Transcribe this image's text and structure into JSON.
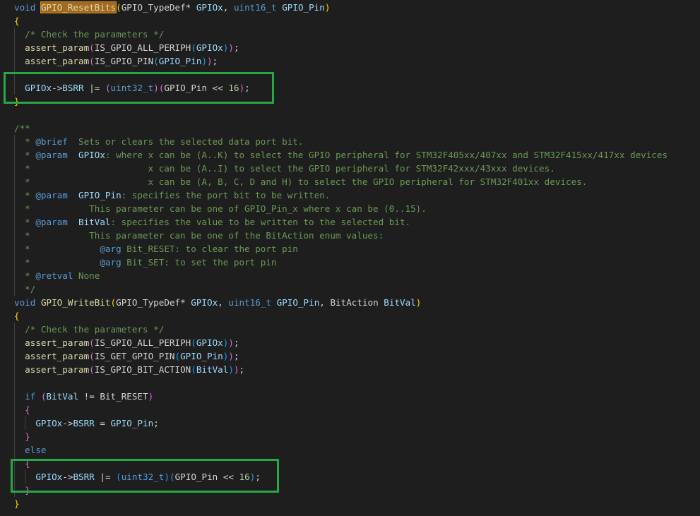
{
  "editor": {
    "lines": [
      [
        [
          "kw",
          "void"
        ],
        [
          "",
          "·"
        ],
        [
          "fn hl",
          "GPIO_ResetBits"
        ],
        [
          "p1",
          "("
        ],
        [
          "",
          "GPIO_TypeDef*"
        ],
        [
          "",
          ""
        ],
        [
          "pm",
          " GPIOx"
        ],
        [
          "",
          ", "
        ],
        [
          "kw",
          "uint16_t"
        ],
        [
          "pm",
          " GPIO_Pin"
        ],
        [
          "p1",
          ")"
        ]
      ],
      [
        [
          "p1",
          "{"
        ]
      ],
      [
        [
          "",
          ""
        ],
        [
          "cm",
          "/* Check the parameters */"
        ]
      ],
      [
        [
          "",
          ""
        ],
        [
          "fn",
          "assert_param"
        ],
        [
          "p2",
          "("
        ],
        [
          "",
          "IS_GPIO_ALL_PERIPH"
        ],
        [
          "p3",
          "("
        ],
        [
          "pm",
          "GPIOx"
        ],
        [
          "p3",
          ")"
        ],
        [
          "p2",
          ")"
        ],
        [
          "",
          ";"
        ]
      ],
      [
        [
          "",
          ""
        ],
        [
          "fn",
          "assert_param"
        ],
        [
          "p2",
          "("
        ],
        [
          "",
          "IS_GPIO_PIN"
        ],
        [
          "p3",
          "("
        ],
        [
          "pm",
          "GPIO_Pin"
        ],
        [
          "p3",
          ")"
        ],
        [
          "p2",
          ")"
        ],
        [
          "",
          ";"
        ]
      ],
      [],
      [
        [
          "",
          ""
        ],
        [
          "pm",
          "GPIOx"
        ],
        [
          "",
          "->"
        ],
        [
          "pm",
          "BSRR"
        ],
        [
          "",
          " |= "
        ],
        [
          "p2",
          "("
        ],
        [
          "kw",
          "uint32_t"
        ],
        [
          "p2",
          ")"
        ],
        [
          "p2",
          "("
        ],
        [
          "",
          "GPIO_Pin << "
        ],
        [
          "num",
          "16"
        ],
        [
          "p2",
          ")"
        ],
        [
          "",
          ";"
        ]
      ],
      [
        [
          "p1",
          "}"
        ]
      ],
      [],
      [
        [
          "cm",
          "/**"
        ]
      ],
      [
        [
          "cm",
          "  * "
        ],
        [
          "doc",
          "@brief"
        ],
        [
          "cm",
          "  Sets or clears the selected data port bit."
        ]
      ],
      [
        [
          "cm",
          "  * "
        ],
        [
          "doc",
          "@param"
        ],
        [
          "cm",
          "  "
        ],
        [
          "pm",
          "GPIOx"
        ],
        [
          "cm",
          ": where x can be (A..K) to select the GPIO peripheral for STM32F405xx/407xx and STM32F415xx/417xx devices"
        ]
      ],
      [
        [
          "cm",
          "  *                      x can be (A..I) to select the GPIO peripheral for STM32F42xxx/43xxx devices."
        ]
      ],
      [
        [
          "cm",
          "  *                      x can be (A, B, C, D and H) to select the GPIO peripheral for STM32F401xx devices."
        ]
      ],
      [
        [
          "cm",
          "  * "
        ],
        [
          "doc",
          "@param"
        ],
        [
          "cm",
          "  "
        ],
        [
          "pm",
          "GPIO_Pin"
        ],
        [
          "cm",
          ": specifies the port bit to be written."
        ]
      ],
      [
        [
          "cm",
          "  *           This parameter can be one of GPIO_Pin_x where x can be (0..15)."
        ]
      ],
      [
        [
          "cm",
          "  * "
        ],
        [
          "doc",
          "@param"
        ],
        [
          "cm",
          "  "
        ],
        [
          "pm",
          "BitVal"
        ],
        [
          "cm",
          ": specifies the value to be written to the selected bit."
        ]
      ],
      [
        [
          "cm",
          "  *           This parameter can be one of the BitAction enum values:"
        ]
      ],
      [
        [
          "cm",
          "  *             "
        ],
        [
          "doc",
          "@arg"
        ],
        [
          "cm",
          " Bit_RESET: to clear the port pin"
        ]
      ],
      [
        [
          "cm",
          "  *             "
        ],
        [
          "doc",
          "@arg"
        ],
        [
          "cm",
          " Bit_SET: to set the port pin"
        ]
      ],
      [
        [
          "cm",
          "  * "
        ],
        [
          "doc",
          "@retval"
        ],
        [
          "cm",
          " None"
        ]
      ],
      [
        [
          "cm",
          "  */"
        ]
      ],
      [
        [
          "kw",
          "void"
        ],
        [
          "",
          " "
        ],
        [
          "fn",
          "GPIO_WriteBit"
        ],
        [
          "p1",
          "("
        ],
        [
          "",
          "GPIO_TypeDef*"
        ],
        [
          "pm",
          " GPIOx"
        ],
        [
          "",
          ", "
        ],
        [
          "kw",
          "uint16_t"
        ],
        [
          "pm",
          " GPIO_Pin"
        ],
        [
          "",
          ", BitAction "
        ],
        [
          "pm",
          "BitVal"
        ],
        [
          "p1",
          ")"
        ]
      ],
      [
        [
          "p1",
          "{"
        ]
      ],
      [
        [
          "",
          ""
        ],
        [
          "cm",
          "/* Check the parameters */"
        ]
      ],
      [
        [
          "",
          ""
        ],
        [
          "fn",
          "assert_param"
        ],
        [
          "p2",
          "("
        ],
        [
          "",
          "IS_GPIO_ALL_PERIPH"
        ],
        [
          "p3",
          "("
        ],
        [
          "pm",
          "GPIOx"
        ],
        [
          "p3",
          ")"
        ],
        [
          "p2",
          ")"
        ],
        [
          "",
          ";"
        ]
      ],
      [
        [
          "",
          ""
        ],
        [
          "fn",
          "assert_param"
        ],
        [
          "p2",
          "("
        ],
        [
          "",
          "IS_GET_GPIO_PIN"
        ],
        [
          "p3",
          "("
        ],
        [
          "pm",
          "GPIO_Pin"
        ],
        [
          "p3",
          ")"
        ],
        [
          "p2",
          ")"
        ],
        [
          "",
          ";"
        ]
      ],
      [
        [
          "",
          ""
        ],
        [
          "fn",
          "assert_param"
        ],
        [
          "p2",
          "("
        ],
        [
          "",
          "IS_GPIO_BIT_ACTION"
        ],
        [
          "p3",
          "("
        ],
        [
          "pm",
          "BitVal"
        ],
        [
          "p3",
          ")"
        ],
        [
          "p2",
          ")"
        ],
        [
          "",
          ";"
        ]
      ],
      [],
      [
        [
          "",
          ""
        ],
        [
          "kw",
          "if"
        ],
        [
          "",
          " "
        ],
        [
          "p2",
          "("
        ],
        [
          "pm",
          "BitVal"
        ],
        [
          "",
          " != Bit_RESET"
        ],
        [
          "p2",
          ")"
        ]
      ],
      [
        [
          "",
          ""
        ],
        [
          "p2",
          "{"
        ]
      ],
      [
        [
          "",
          ""
        ],
        [
          "pm",
          "GPIOx"
        ],
        [
          "",
          "->"
        ],
        [
          "pm",
          "BSRR"
        ],
        [
          "",
          " = "
        ],
        [
          "pm",
          "GPIO_Pin"
        ],
        [
          "",
          ";"
        ]
      ],
      [
        [
          "",
          ""
        ],
        [
          "p2",
          "}"
        ]
      ],
      [
        [
          "",
          ""
        ],
        [
          "kw",
          "else"
        ]
      ],
      [
        [
          "",
          ""
        ],
        [
          "p2",
          "{"
        ]
      ],
      [
        [
          "",
          ""
        ],
        [
          "pm",
          "GPIOx"
        ],
        [
          "",
          "->"
        ],
        [
          "pm",
          "BSRR"
        ],
        [
          "",
          " |= "
        ],
        [
          "p3",
          "("
        ],
        [
          "kw",
          "uint32_t"
        ],
        [
          "p3",
          ")"
        ],
        [
          "p3",
          "("
        ],
        [
          "",
          "GPIO_Pin << "
        ],
        [
          "num",
          "16"
        ],
        [
          "p3",
          ")"
        ],
        [
          "",
          ";"
        ]
      ],
      [
        [
          "",
          ""
        ],
        [
          "p2",
          "}"
        ]
      ],
      [
        [
          "p1",
          "}"
        ]
      ]
    ],
    "colors": {
      "background": "#1e1e1e",
      "keyword": "#569cd6",
      "function": "#dcdcaa",
      "parameter": "#9cdcfe",
      "comment": "#6a9955",
      "number": "#b5cea8",
      "highlight_box": "#28a745",
      "selection": "#a36a1e"
    }
  }
}
